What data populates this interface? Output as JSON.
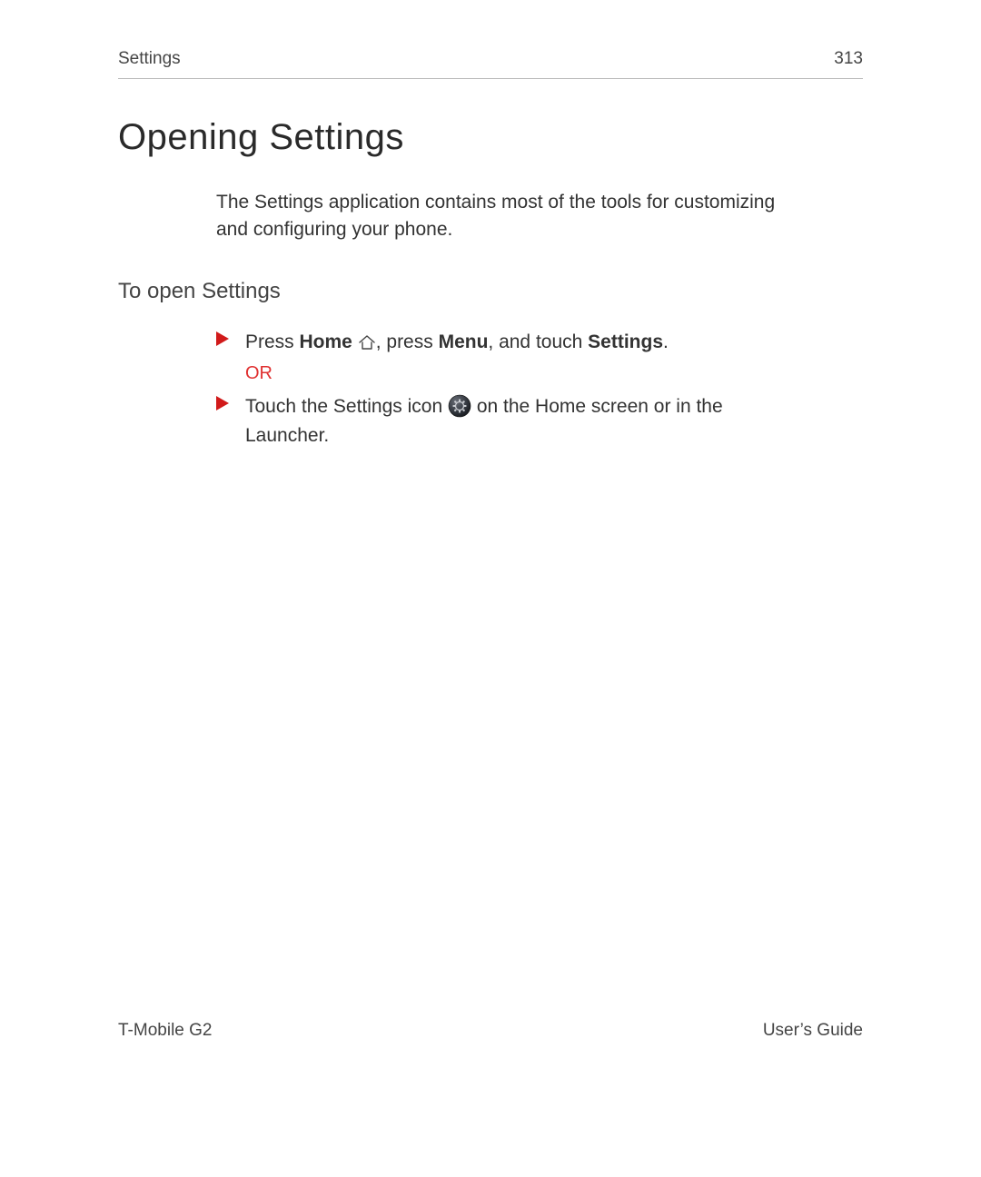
{
  "header": {
    "section": "Settings",
    "page_number": "313"
  },
  "title": "Opening Settings",
  "intro": "The Settings application contains most of the tools for customizing and configuring your phone.",
  "subsection": "To open Settings",
  "step1": {
    "pre": "Press ",
    "home": "Home",
    "mid": ", press ",
    "menu": "Menu",
    "mid2": ", and touch ",
    "settings": "Settings",
    "end": ".",
    "or": "OR"
  },
  "step2": {
    "pre": "Touch the Settings icon ",
    "post": " on the Home screen or in the Launcher."
  },
  "footer": {
    "left": "T-Mobile G2",
    "right": "User’s Guide"
  }
}
